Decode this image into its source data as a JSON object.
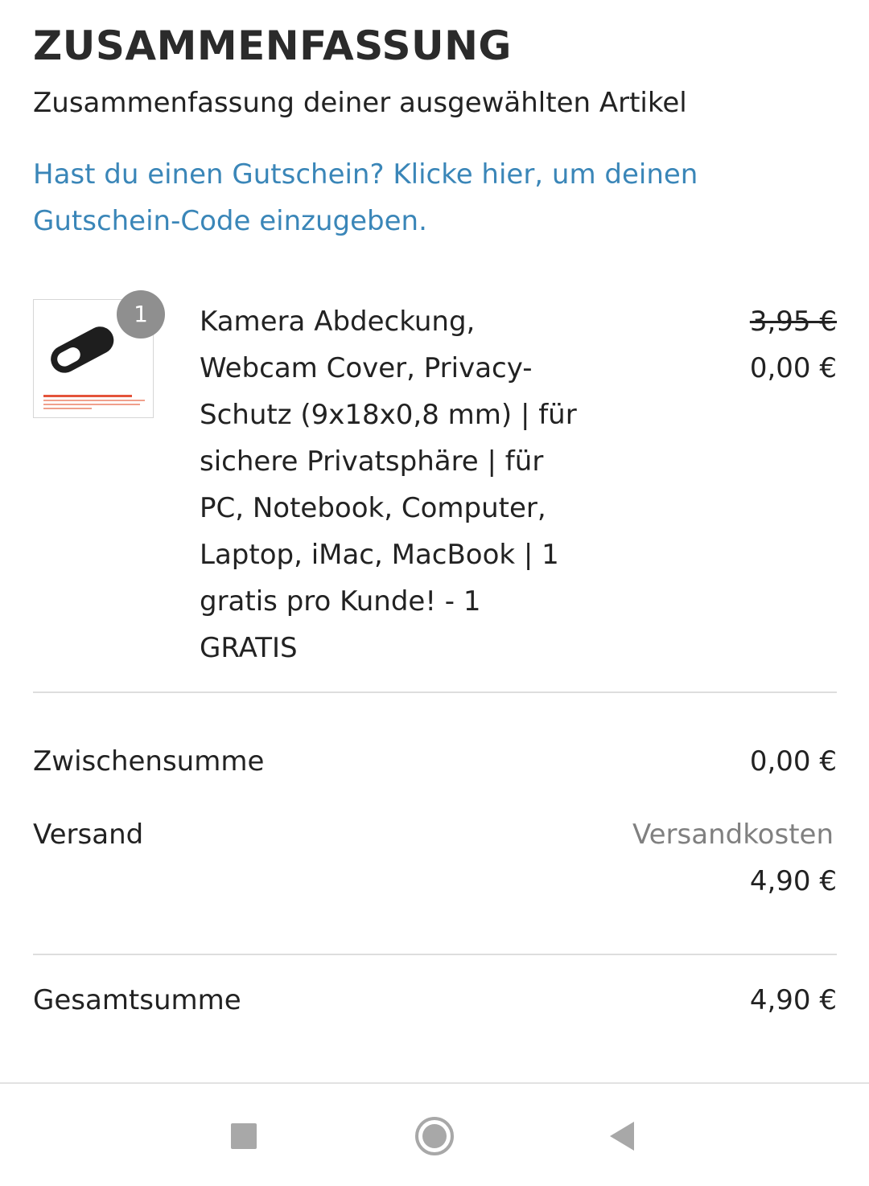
{
  "header": {
    "title": "ZUSAMMENFASSUNG",
    "subtitle": "Zusammenfassung deiner ausgewählten Artikel"
  },
  "coupon": {
    "link_text": "Hast du einen Gutschein? Klicke hier, um deinen Gutschein-Code einzugeben."
  },
  "cart": {
    "items": [
      {
        "quantity": "1",
        "name": "Kamera Abdeckung, Webcam Cover, Privacy-Schutz (9x18x0,8 mm) | für sichere Privatsphäre | für PC, Notebook, Computer, Laptop, iMac, MacBook | 1 gratis pro Kunde! - 1 GRATIS",
        "old_price": "3,95 €",
        "price": "0,00 €",
        "image_icon": "webcam-cover-product-image"
      }
    ]
  },
  "totals": {
    "subtotal_label": "Zwischensumme",
    "subtotal_value": "0,00 €",
    "shipping_label": "Versand",
    "shipping_note": "Versandkosten",
    "shipping_value": "4,90 €",
    "total_label": "Gesamtsumme",
    "total_value": "4,90 €"
  },
  "navbar": {
    "recents_icon": "square-icon",
    "home_icon": "circle-home-icon",
    "back_icon": "triangle-back-icon"
  },
  "colors": {
    "link": "#3a86b8",
    "badge": "#8f8f8f",
    "muted": "#808080",
    "divider": "#dddddd"
  }
}
